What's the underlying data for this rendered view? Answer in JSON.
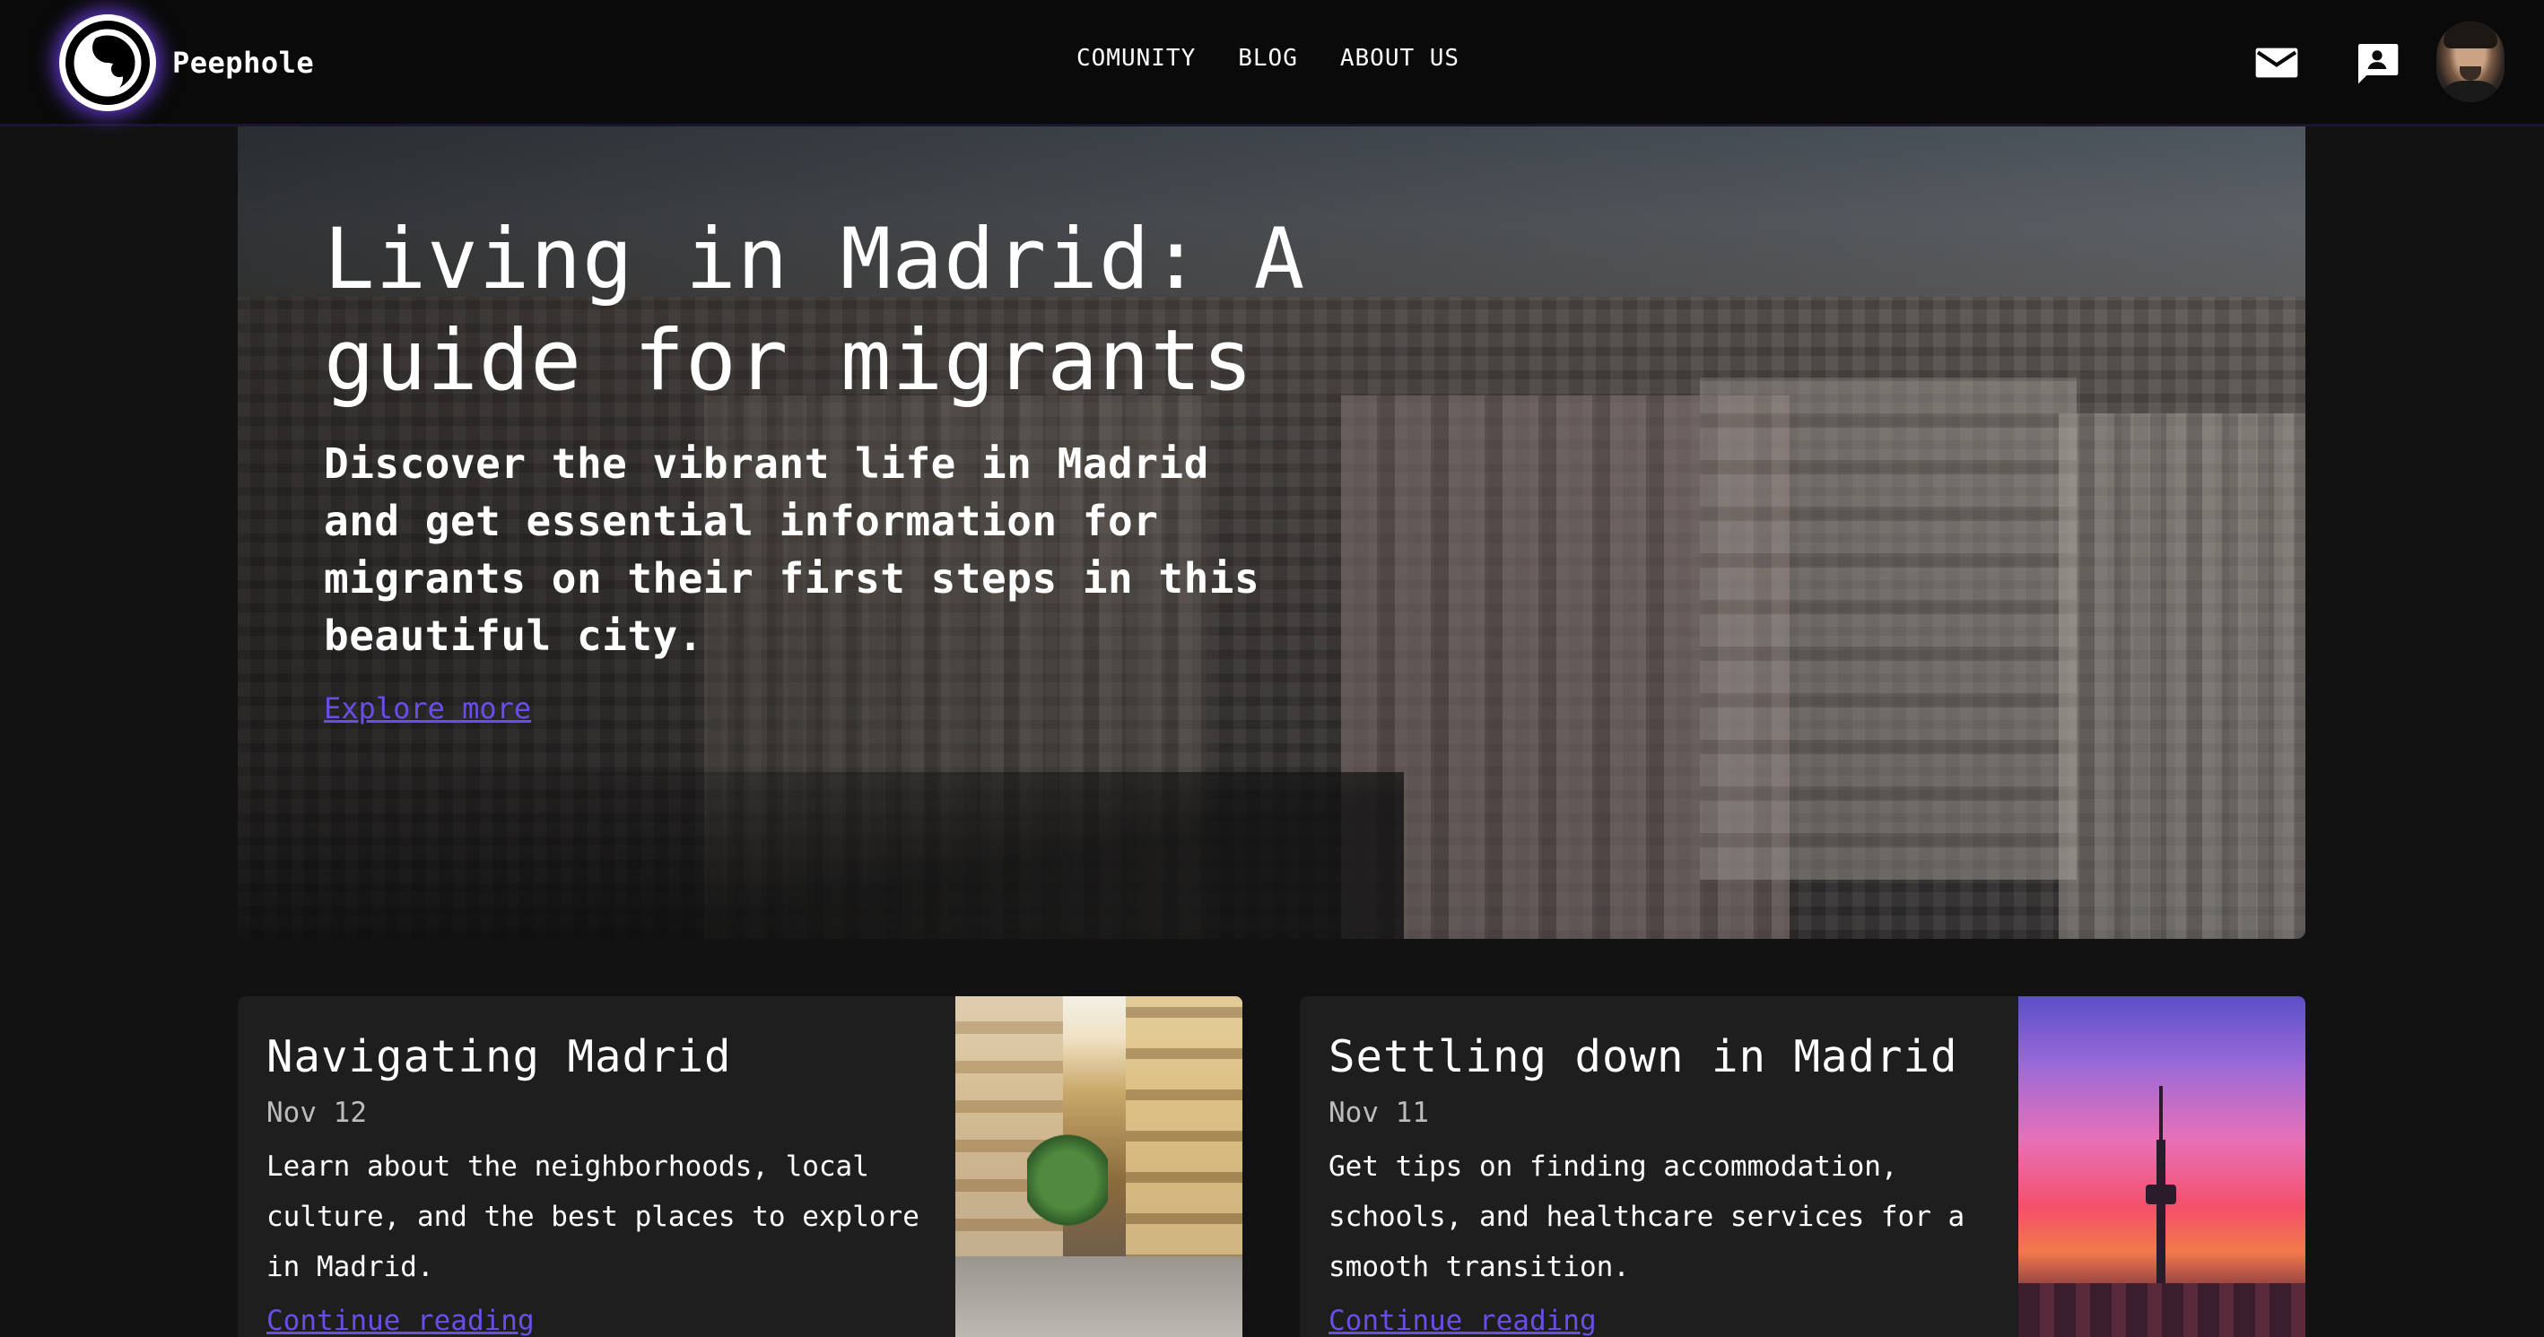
{
  "header": {
    "brand": "Peephole",
    "nav": [
      "COMUNITY",
      "BLOG",
      "ABOUT US"
    ],
    "icons": {
      "mail": "mail-icon",
      "chat": "chat-icon",
      "avatar": "user-avatar"
    }
  },
  "hero": {
    "title": "Living in Madrid: A guide for migrants",
    "description": "Discover the vibrant life in Madrid and get essential information for migrants on their first steps in this beautiful city.",
    "link_label": "Explore more"
  },
  "cards": [
    {
      "title": "Navigating Madrid",
      "date": "Nov 12",
      "description": "Learn about the neighborhoods, local culture, and the best places to explore in Madrid.",
      "link_label": "Continue reading"
    },
    {
      "title": "Settling down in Madrid",
      "date": "Nov 11",
      "description": "Get tips on finding accommodation, schools, and healthcare services for a smooth transition.",
      "link_label": "Continue reading"
    }
  ],
  "colors": {
    "accent": "#6b4ee8",
    "background": "#121212",
    "header": "#0a0a0a",
    "card": "#1e1e1e"
  }
}
